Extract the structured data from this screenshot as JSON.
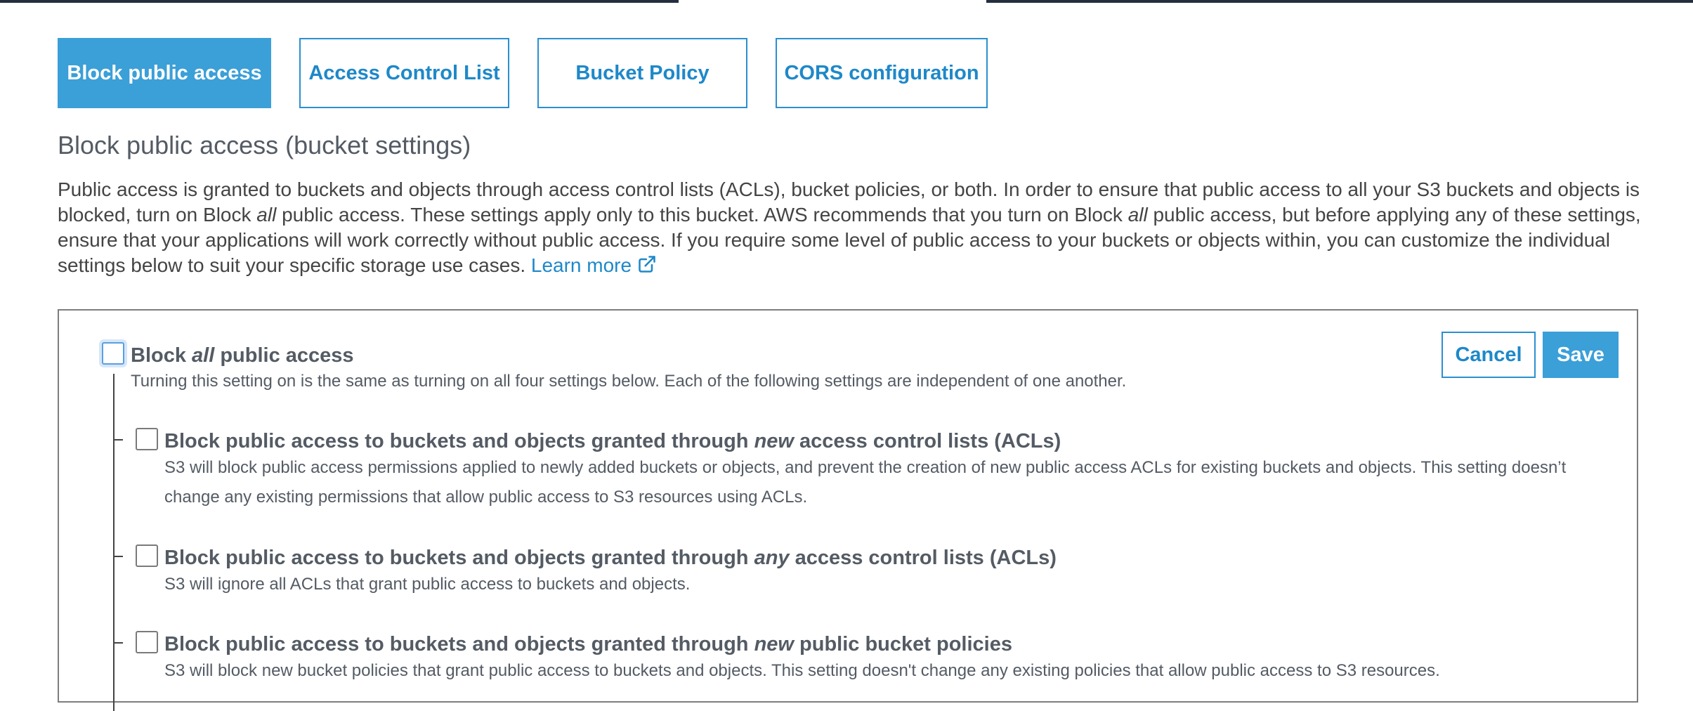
{
  "tabs": [
    {
      "label": "Block public access",
      "active": true
    },
    {
      "label": "Access Control List",
      "active": false
    },
    {
      "label": "Bucket Policy",
      "active": false
    },
    {
      "label": "CORS configuration",
      "active": false
    }
  ],
  "page_title": "Block public access (bucket settings)",
  "intro": {
    "p1": "Public access is granted to buckets and objects through access control lists (ACLs), bucket policies, or both. In order to ensure that public access to all your S3 buckets and objects is blocked, turn on Block ",
    "em1": "all",
    "p2": " public access. These settings apply only to this bucket. AWS recommends that you turn on Block ",
    "em2": "all",
    "p3": " public access, but before applying any of these settings, ensure that your applications will work correctly without public access. If you require some level of public access to your buckets or objects within, you can customize the individual settings below to suit your specific storage use cases. ",
    "learn_more": "Learn more",
    "learn_more_icon": "external-link-icon"
  },
  "buttons": {
    "cancel": "Cancel",
    "save": "Save"
  },
  "block_all": {
    "pre": "Block ",
    "em": "all",
    "post": " public access",
    "desc": "Turning this setting on is the same as turning on all four settings below. Each of the following settings are independent of one another.",
    "checked": false
  },
  "options": [
    {
      "pre": "Block public access to buckets and objects granted through ",
      "em": "new",
      "post": " access control lists (ACLs)",
      "desc": "S3 will block public access permissions applied to newly added buckets or objects, and prevent the creation of new public access ACLs for existing buckets and objects. This setting doesn’t change any existing permissions that allow public access to S3 resources using ACLs.",
      "checked": false
    },
    {
      "pre": "Block public access to buckets and objects granted through ",
      "em": "any",
      "post": " access control lists (ACLs)",
      "desc": "S3 will ignore all ACLs that grant public access to buckets and objects.",
      "checked": false
    },
    {
      "pre": "Block public access to buckets and objects granted through ",
      "em": "new",
      "post": " public bucket policies",
      "desc": "S3 will block new bucket policies that grant public access to buckets and objects. This setting doesn't change any existing policies that allow public access to S3 resources.",
      "checked": false
    }
  ],
  "colors": {
    "accent": "#3b9fd8",
    "link": "#1e88c9",
    "text": "#545b64",
    "topbar": "#232f3e"
  }
}
